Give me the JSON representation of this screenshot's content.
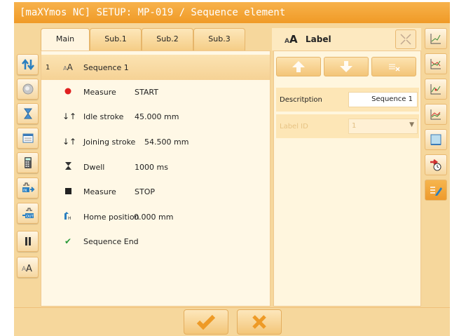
{
  "window": {
    "title": "[maXYmos NC] SETUP: MP-019 / Sequence element"
  },
  "tabs": [
    {
      "label": "Main"
    },
    {
      "label": "Sub.1"
    },
    {
      "label": "Sub.2"
    },
    {
      "label": "Sub.3"
    }
  ],
  "sequence": [
    {
      "num": "1",
      "icon": "label-icon",
      "name": "Sequence 1",
      "value": ""
    },
    {
      "num": "",
      "icon": "measure-start-icon",
      "name": "Measure",
      "value": "START"
    },
    {
      "num": "",
      "icon": "idle-stroke-icon",
      "name": "Idle stroke",
      "value": "45.000 mm"
    },
    {
      "num": "",
      "icon": "joining-stroke-icon",
      "name": "Joining stroke",
      "value": "54.500 mm"
    },
    {
      "num": "",
      "icon": "dwell-icon",
      "name": "Dwell",
      "value": "1000 ms"
    },
    {
      "num": "",
      "icon": "measure-stop-icon",
      "name": "Measure",
      "value": "STOP"
    },
    {
      "num": "",
      "icon": "home-position-icon",
      "name": "Home position",
      "value": "0.000 mm"
    },
    {
      "num": "",
      "icon": "sequence-end-icon",
      "name": "Sequence End",
      "value": ""
    }
  ],
  "right_panel": {
    "header": "Label",
    "description_label": "Descritption",
    "description_value": "Sequence 1",
    "label_id_label": "Label ID",
    "label_id_value": "1"
  },
  "colors": {
    "accent": "#f09a26",
    "panel": "#f6d79c",
    "selected": "#f6d295"
  }
}
